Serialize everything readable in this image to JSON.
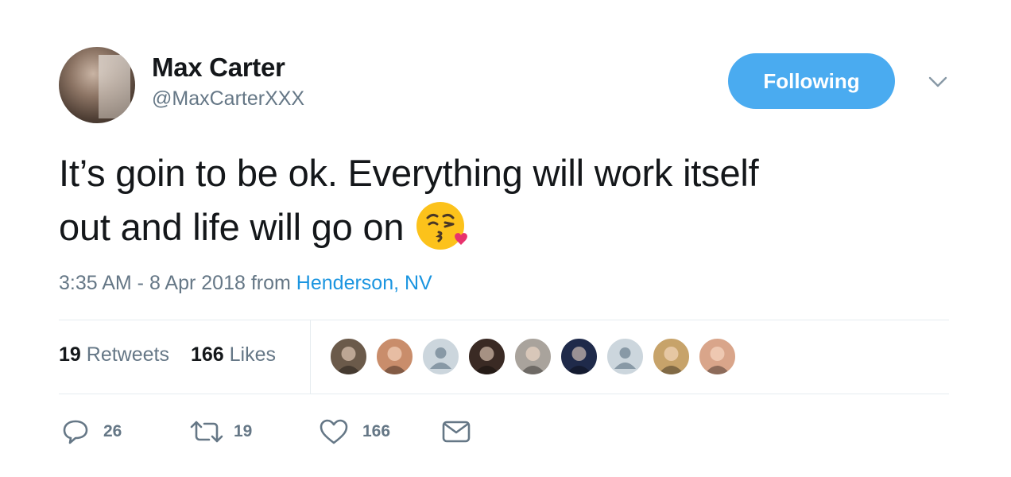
{
  "author": {
    "display_name": "Max Carter",
    "handle": "@MaxCarterXXX"
  },
  "follow_button": {
    "label": "Following",
    "color": "#4aabf0"
  },
  "tweet": {
    "text_line1": "It’s goin to be ok. Everything will work itself",
    "text_line2": "out and life will go on",
    "emoji": "face-throwing-a-kiss"
  },
  "meta": {
    "time": "3:35 AM - 8 Apr 2018",
    "from": "from",
    "location": "Henderson, NV",
    "location_color": "#1b95e0"
  },
  "stats": {
    "retweets_count": "19",
    "retweets_label": "Retweets",
    "likes_count": "166",
    "likes_label": "Likes"
  },
  "likers": [
    {
      "name": "liker-avatar-1",
      "color": "#6b5a4a"
    },
    {
      "name": "liker-avatar-2",
      "color": "#c98d6b"
    },
    {
      "name": "liker-avatar-3-default",
      "color": "#ccd6dd"
    },
    {
      "name": "liker-avatar-4",
      "color": "#3a2a24"
    },
    {
      "name": "liker-avatar-5",
      "color": "#a9a39c"
    },
    {
      "name": "liker-avatar-6",
      "color": "#1f2a4a"
    },
    {
      "name": "liker-avatar-7-default",
      "color": "#ccd6dd"
    },
    {
      "name": "liker-avatar-8",
      "color": "#c7a36a"
    },
    {
      "name": "liker-avatar-9",
      "color": "#d9a58a"
    }
  ],
  "actions": {
    "reply_count": "26",
    "retweet_count": "19",
    "like_count": "166",
    "icons": [
      "reply-icon",
      "retweet-icon",
      "like-icon",
      "message-icon"
    ]
  }
}
